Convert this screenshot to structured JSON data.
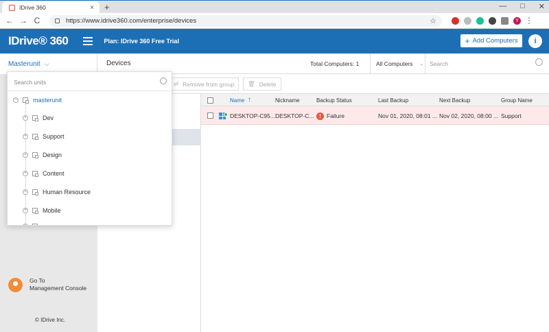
{
  "browser": {
    "tab_title": "IDrive 360",
    "tab_close": "×",
    "new_tab": "+",
    "url": "https://www.idrive360.com/enterprise/devices",
    "nav_back": "←",
    "nav_forward": "→",
    "nav_reload": "C",
    "star": "☆",
    "profile_initial": "Y",
    "menu": "⋮",
    "window_min": "—",
    "window_max": "□",
    "window_close": "✕"
  },
  "header": {
    "logo": "IDrive® 360",
    "plan": "Plan: IDrive 360 Free Trial",
    "add_computers": "Add Computers",
    "add_plus": "+",
    "info": "i"
  },
  "subheader": {
    "unit_selector": "Masterunit",
    "page_title": "Devices",
    "total_computers": "Total Computers: 1",
    "filter": "All Computers",
    "search_placeholder": "Search"
  },
  "actions": {
    "remove_from_group": "Remove from group",
    "delete": "Delete"
  },
  "dropdown": {
    "search_placeholder": "Search units",
    "root": "masterunit",
    "items": [
      "Dev",
      "Support",
      "Design",
      "Content",
      "Human Resource",
      "Mobile"
    ]
  },
  "table": {
    "headers": {
      "name": "Name",
      "sort": "↑",
      "nickname": "Nickname",
      "backup_status": "Backup Status",
      "last_backup": "Last Backup",
      "next_backup": "Next Backup",
      "group_name": "Group Name"
    },
    "rows": [
      {
        "name": "DESKTOP-C95...",
        "nickname": "DESKTOP-C...",
        "status": "Failure",
        "last_backup": "Nov 01, 2020, 08:01 ...",
        "next_backup": "Nov 02, 2020, 08:00 ...",
        "group": "Support"
      }
    ]
  },
  "sidebar": {
    "goto_line1": "Go To",
    "goto_line2": "Management Console",
    "copyright": "© IDrive Inc."
  },
  "colors": {
    "brand": "#1d6fb5",
    "failure": "#e8563f",
    "row_highlight": "#fde9ea"
  }
}
